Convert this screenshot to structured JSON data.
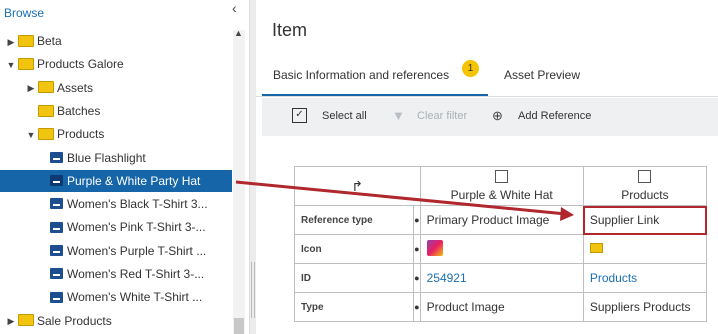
{
  "left_panel": {
    "title": "Browse",
    "tree": [
      {
        "label": "Beta",
        "type": "folder",
        "indent": 1,
        "twisty": "collapsed"
      },
      {
        "label": "Products Galore",
        "type": "folder",
        "indent": 1,
        "twisty": "expanded"
      },
      {
        "label": "Assets",
        "type": "folder",
        "indent": 2,
        "twisty": "collapsed"
      },
      {
        "label": "Batches",
        "type": "folder",
        "indent": 2,
        "twisty": "none"
      },
      {
        "label": "Products",
        "type": "folder",
        "indent": 2,
        "twisty": "expanded"
      },
      {
        "label": "Blue Flashlight",
        "type": "item",
        "indent": 3
      },
      {
        "label": "Purple & White Party Hat",
        "type": "item",
        "indent": 3,
        "selected": true
      },
      {
        "label": "Women's Black T-Shirt 3...",
        "type": "item",
        "indent": 3
      },
      {
        "label": "Women's Pink T-Shirt 3-...",
        "type": "item",
        "indent": 3
      },
      {
        "label": "Women's Purple T-Shirt ...",
        "type": "item",
        "indent": 3
      },
      {
        "label": "Women's Red T-Shirt 3-...",
        "type": "item",
        "indent": 3
      },
      {
        "label": "Women's White T-Shirt ...",
        "type": "item",
        "indent": 3
      },
      {
        "label": "Sale Products",
        "type": "folder",
        "indent": 1,
        "twisty": "collapsed"
      }
    ]
  },
  "main": {
    "title": "Item",
    "tabs": [
      {
        "label": "Basic Information and references",
        "badge": "1",
        "active": true
      },
      {
        "label": "Asset Preview",
        "active": false
      }
    ],
    "toolbar": {
      "select_all": "Select all",
      "clear_filter": "Clear filter",
      "add_reference": "Add Reference"
    },
    "table": {
      "columns": [
        "Purple & White Hat",
        "Products"
      ],
      "rows": [
        {
          "label": "Reference type",
          "values": [
            "Primary Product Image",
            "Supplier Link"
          ]
        },
        {
          "label": "Icon",
          "values": [
            "",
            ""
          ]
        },
        {
          "label": "ID",
          "values": [
            "254921",
            "Products"
          ]
        },
        {
          "label": "Type",
          "values": [
            "Product Image",
            "Suppliers Products"
          ]
        }
      ]
    }
  },
  "colors": {
    "accent": "#1565a8",
    "highlight": "#b0272d",
    "badge": "#f5c400"
  }
}
